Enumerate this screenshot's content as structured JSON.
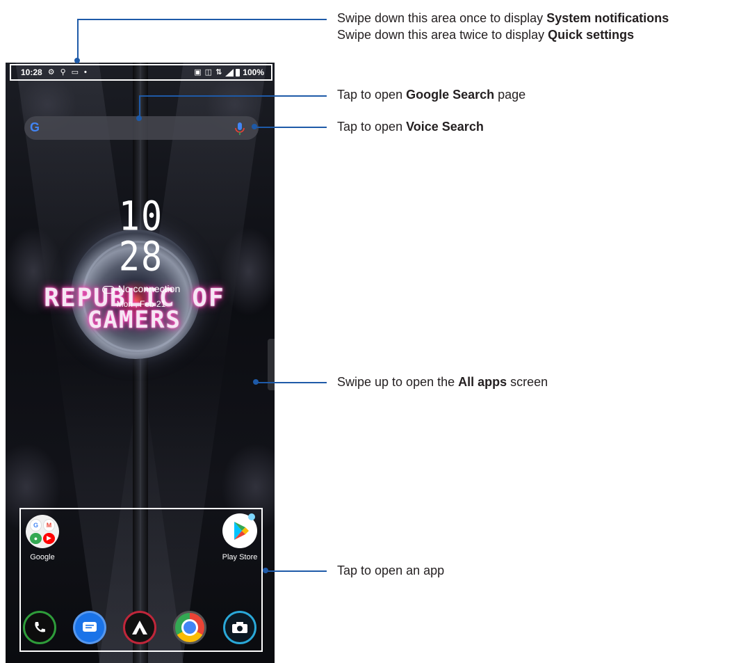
{
  "status_bar": {
    "time": "10:28",
    "left_icons": [
      "settings-icon",
      "pin-icon",
      "image-icon",
      "dot-icon"
    ],
    "right_icons": [
      "hd-voice-icon",
      "vibrate-icon",
      "lte-icon",
      "signal-icon",
      "battery-icon"
    ],
    "battery_percent": "100%"
  },
  "search_bar": {
    "logo": "G",
    "icons": [
      "google-logo-icon",
      "mic-icon"
    ]
  },
  "clock_widget": {
    "hour": "10",
    "minute": "28",
    "weather": "No connection",
    "date": "Mon , Feb 21"
  },
  "wallpaper_text": {
    "line1": "REPUBLIC OF",
    "line2": "GAMERS"
  },
  "home_apps": [
    {
      "label": "Google",
      "icon": "google-folder-icon"
    },
    {
      "label": "Play Store",
      "icon": "play-store-icon"
    }
  ],
  "dock_apps": [
    {
      "icon": "phone-icon"
    },
    {
      "icon": "messages-icon"
    },
    {
      "icon": "armoury-crate-icon"
    },
    {
      "icon": "chrome-icon"
    },
    {
      "icon": "camera-icon"
    }
  ],
  "callouts": {
    "notifications": {
      "line1_prefix": "Swipe down this area once to display ",
      "line1_bold": "System notifications",
      "line2_prefix": "Swipe down this area twice to display ",
      "line2_bold": "Quick settings"
    },
    "google_search": {
      "prefix": "Tap to open ",
      "bold": "Google Search",
      "suffix": " page"
    },
    "voice_search": {
      "prefix": "Tap to open ",
      "bold": "Voice Search"
    },
    "all_apps": {
      "prefix": "Swipe up to open the ",
      "bold": "All apps",
      "suffix": " screen"
    },
    "open_app": {
      "text": "Tap to open an app"
    }
  },
  "colors": {
    "callout_line": "#1e5aa8",
    "callout_text": "#231f20"
  }
}
